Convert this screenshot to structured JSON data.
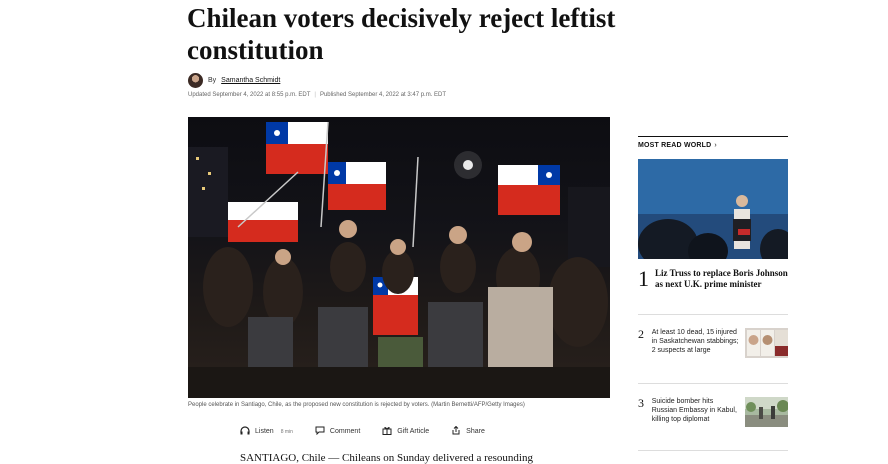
{
  "article": {
    "headline": "Chilean voters decisively reject leftist constitution",
    "by_prefix": "By",
    "author": "Samantha Schmidt",
    "updated": "Updated September 4, 2022 at 8:55 p.m. EDT",
    "published": "Published September 4, 2022 at 3:47 p.m. EDT",
    "caption": "People celebrate in Santiago, Chile, as the proposed new constitution is rejected by voters. (Martin Bernetti/AFP/Getty Images)",
    "lede": "SANTIAGO, Chile — Chileans on Sunday delivered a resounding"
  },
  "actions": {
    "listen_label": "Listen",
    "listen_minutes": "8 min",
    "comment_label": "Comment",
    "gift_label": "Gift Article",
    "share_label": "Share",
    "icons": [
      "headphones-icon",
      "comment-icon",
      "gift-icon",
      "share-icon"
    ]
  },
  "most_read": {
    "title": "MOST READ WORLD",
    "chevron": "›",
    "items": [
      {
        "num": "1",
        "text": "Liz Truss to replace Boris Johnson as next U.K. prime minister"
      },
      {
        "num": "2",
        "text": "At least 10 dead, 15 injured in Saskatchewan stabbings; 2 suspects at large"
      },
      {
        "num": "3",
        "text": "Suicide bomber hits Russian Embassy in Kabul, killing top diplomat"
      }
    ]
  },
  "colors": {
    "flag_red": "#d52b1e",
    "flag_blue": "#0039a6",
    "flag_white": "#ffffff"
  }
}
